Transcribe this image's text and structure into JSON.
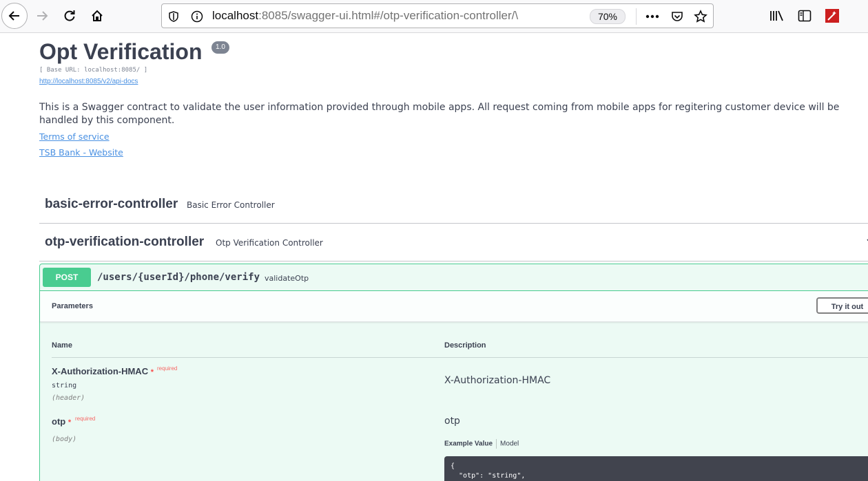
{
  "browser": {
    "url_host": "localhost",
    "url_rest": ":8085/swagger-ui.html#/otp-verification-controller/\\",
    "zoom": "70%"
  },
  "page": {
    "title": "Opt Verification",
    "version": "1.0",
    "base_url": "[ Base URL: localhost:8085/ ]",
    "api_docs_link": "http://localhost:8085/v2/api-docs",
    "description": "This is a Swagger contract to validate the user information provided through mobile apps. All request coming from mobile apps for regitering customer device will be handled by this component.",
    "terms_link": "Terms of service",
    "website_link": "TSB Bank - Website"
  },
  "controllers": [
    {
      "name": "basic-error-controller",
      "description": "Basic Error Controller"
    },
    {
      "name": "otp-verification-controller",
      "description": "Otp Verification Controller"
    }
  ],
  "operation": {
    "method": "POST",
    "path": "/users/{userId}/phone/verify",
    "operation_id": "validateOtp",
    "section_title": "Parameters",
    "try_button": "Try it out",
    "col_name": "Name",
    "col_description": "Description",
    "params": [
      {
        "name": "X-Authorization-HMAC",
        "required": "required",
        "type": "string",
        "in": "(header)",
        "description": "X-Authorization-HMAC"
      },
      {
        "name": "otp",
        "required": "required",
        "in": "(body)",
        "description": "otp"
      }
    ],
    "example_tab": "Example Value",
    "model_tab": "Model",
    "code_line1": "{",
    "code_line2": "  \"otp\": \"string\","
  },
  "colors": {
    "post_green": "#49cc90",
    "link_blue": "#4990e2",
    "required_red": "#ff0000"
  }
}
